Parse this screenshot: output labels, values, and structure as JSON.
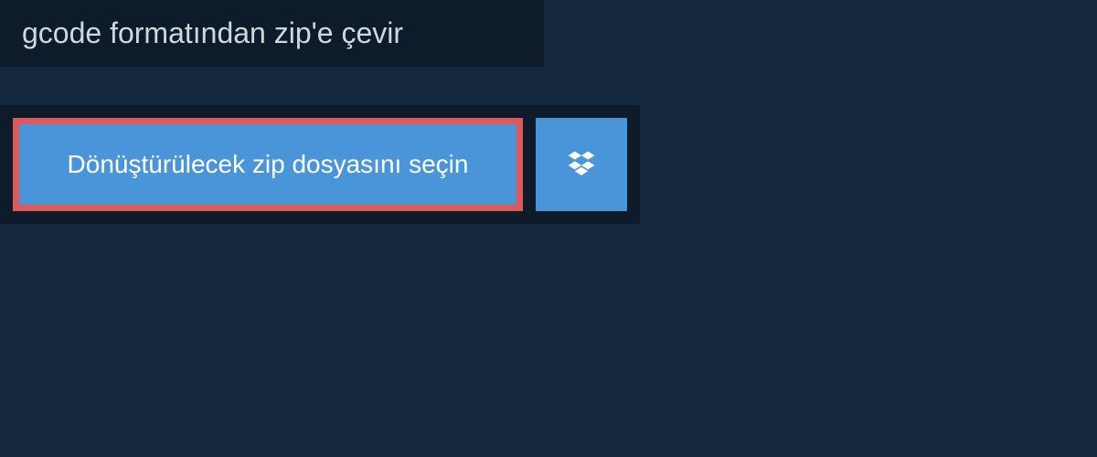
{
  "header": {
    "title": "gcode formatından zip'e çevir"
  },
  "actions": {
    "select_file_label": "Dönüştürülecek zip dosyasını seçin"
  },
  "colors": {
    "background": "#14293e",
    "panel": "#0d1b2a",
    "button": "#4a95d9",
    "highlight_border": "#dc5a5a",
    "text_light": "#cfd8dc",
    "text_white": "#ffffff"
  }
}
